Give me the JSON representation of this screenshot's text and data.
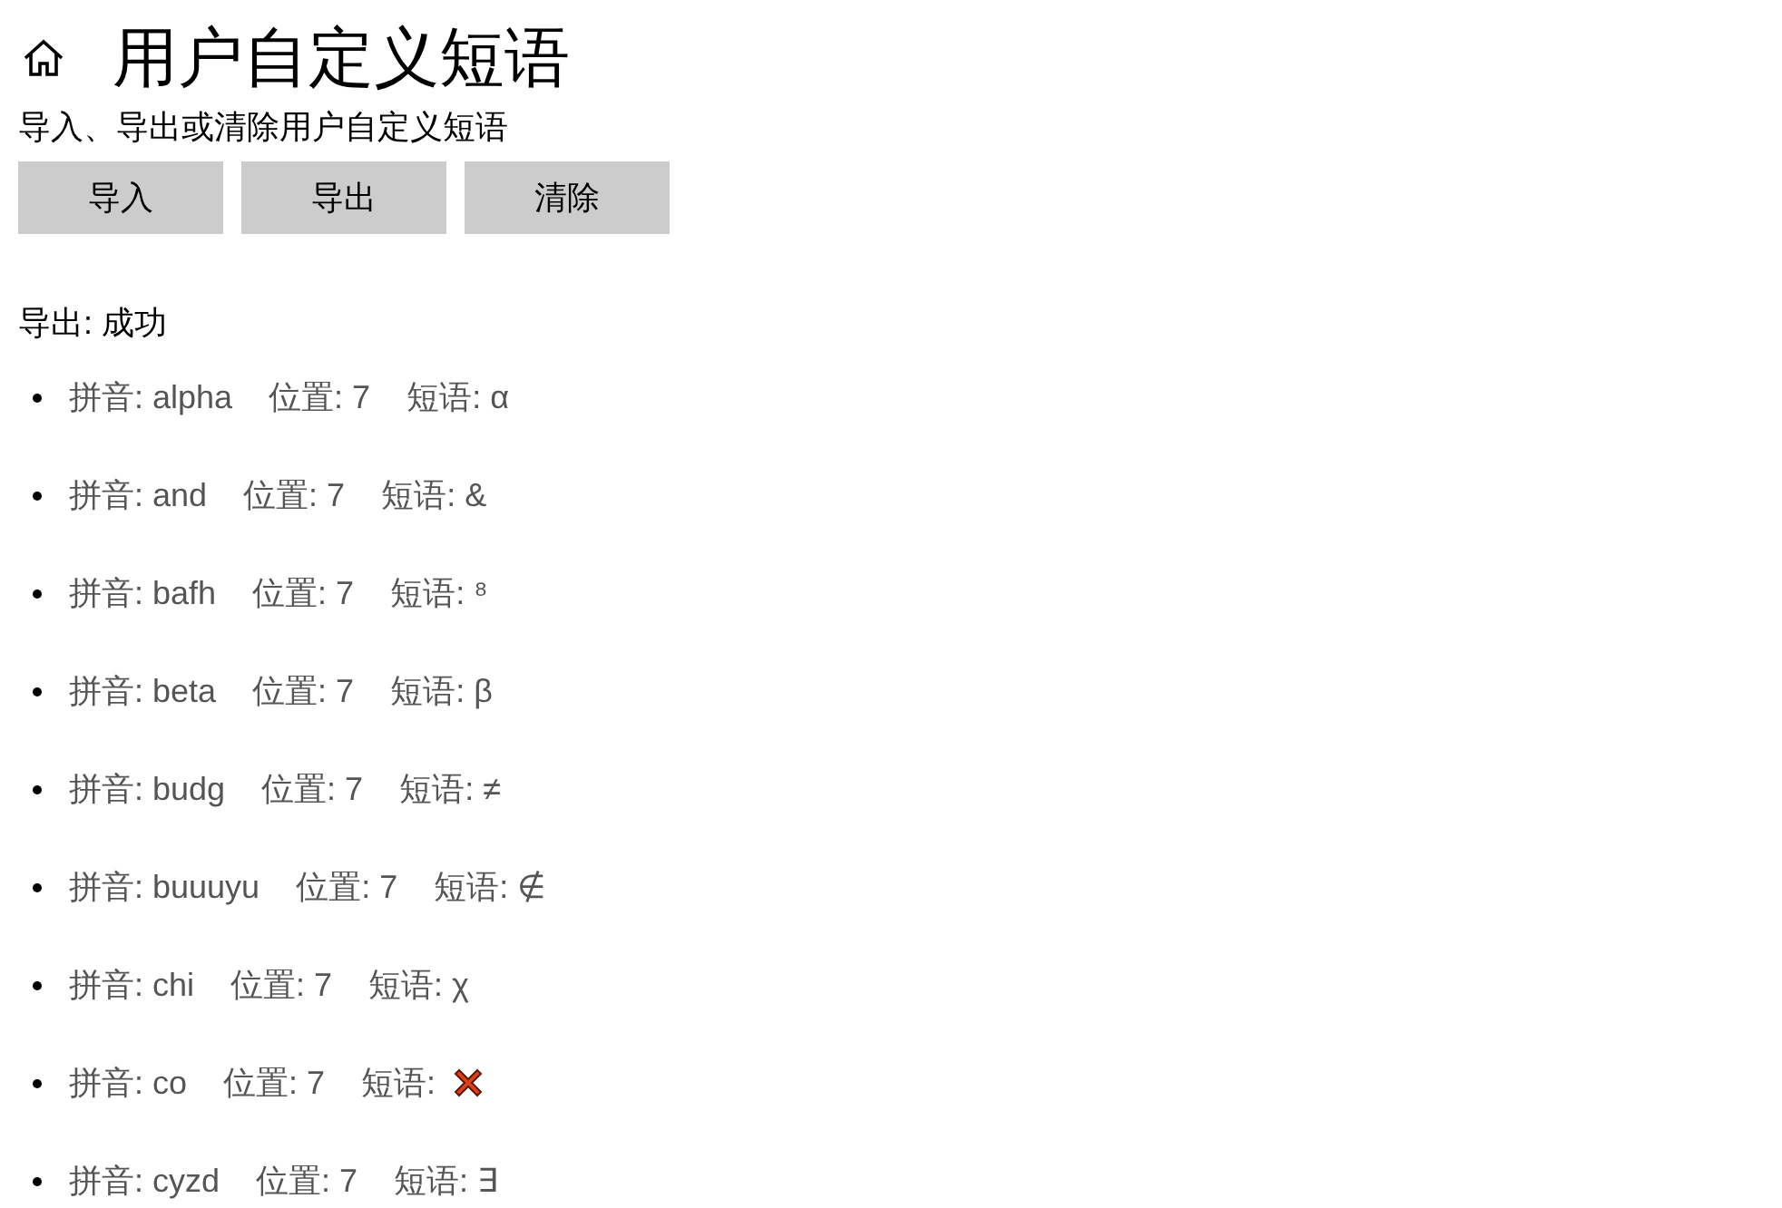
{
  "page": {
    "title": "用户自定义短语",
    "subtitle": "导入、导出或清除用户自定义短语"
  },
  "buttons": [
    "导入",
    "导出",
    "清除"
  ],
  "status": "导出: 成功",
  "phrases": [
    {
      "pinyin": "拼音: alpha",
      "position": "位置: 7",
      "phrase_label": "短语:",
      "kind": "text",
      "phrase": "α"
    },
    {
      "pinyin": "拼音: and",
      "position": "位置: 7",
      "phrase_label": "短语:",
      "kind": "text",
      "phrase": "&"
    },
    {
      "pinyin": "拼音: bafh",
      "position": "位置: 7",
      "phrase_label": "短语:",
      "kind": "text",
      "phrase": "⁸"
    },
    {
      "pinyin": "拼音: beta",
      "position": "位置: 7",
      "phrase_label": "短语:",
      "kind": "text",
      "phrase": "β"
    },
    {
      "pinyin": "拼音: budg",
      "position": "位置: 7",
      "phrase_label": "短语:",
      "kind": "text",
      "phrase": "≠"
    },
    {
      "pinyin": "拼音: buuuyu",
      "position": "位置: 7",
      "phrase_label": "短语:",
      "kind": "text",
      "phrase": "∉"
    },
    {
      "pinyin": "拼音: chi",
      "position": "位置: 7",
      "phrase_label": "短语:",
      "kind": "text",
      "phrase": "χ"
    },
    {
      "pinyin": "拼音: co",
      "position": "位置: 7",
      "phrase_label": "短语:",
      "kind": "cross"
    },
    {
      "pinyin": "拼音: cyzd",
      "position": "位置: 7",
      "phrase_label": "短语:",
      "kind": "text",
      "phrase": "∃"
    }
  ]
}
